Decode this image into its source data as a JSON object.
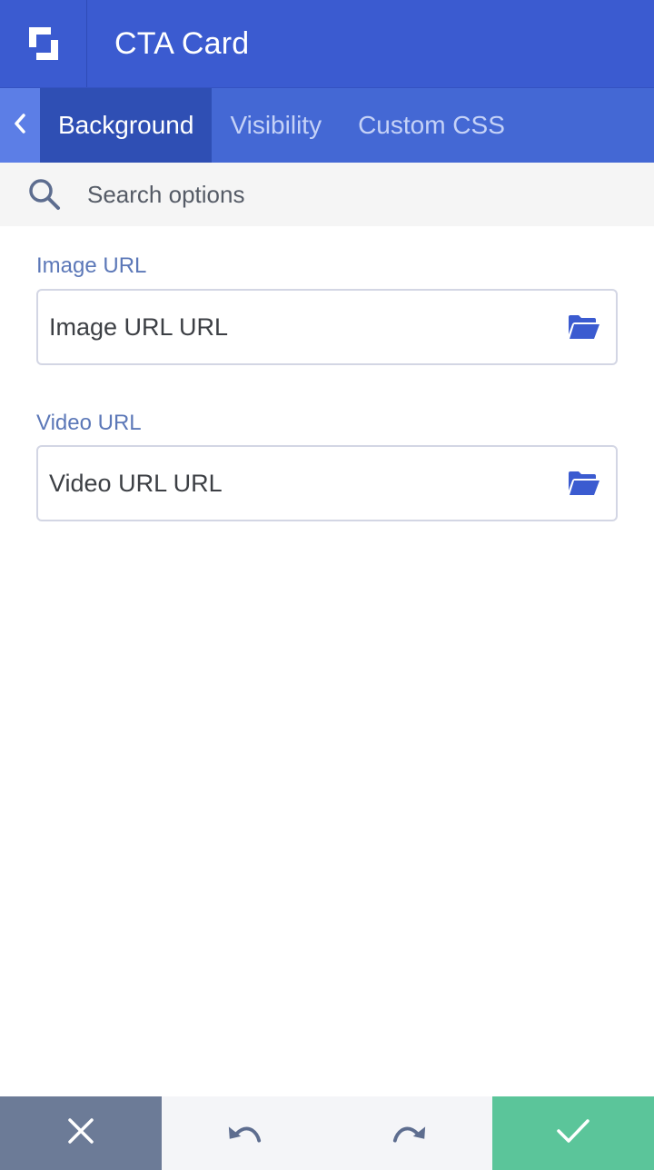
{
  "header": {
    "title": "CTA Card",
    "logo_icon": "builder-logo-icon"
  },
  "tabs": {
    "back_icon": "chevron-left-icon",
    "items": [
      {
        "label": "Background",
        "active": true
      },
      {
        "label": "Visibility",
        "active": false
      },
      {
        "label": "Custom CSS",
        "active": false
      }
    ]
  },
  "search": {
    "placeholder": "Search options",
    "icon": "search-icon"
  },
  "fields": [
    {
      "label": "Image URL",
      "value": "Image URL URL",
      "icon": "folder-open-icon"
    },
    {
      "label": "Video URL",
      "value": "Video URL URL",
      "icon": "folder-open-icon"
    }
  ],
  "footer": {
    "cancel_icon": "close-icon",
    "undo_icon": "undo-icon",
    "redo_icon": "redo-icon",
    "save_icon": "check-icon"
  },
  "colors": {
    "header": "#3b5bd0",
    "tab_bar": "#4468d4",
    "tab_active": "#2f4fb4",
    "label": "#5c78b8",
    "cancel": "#6c7b97",
    "save": "#5bc59a"
  }
}
